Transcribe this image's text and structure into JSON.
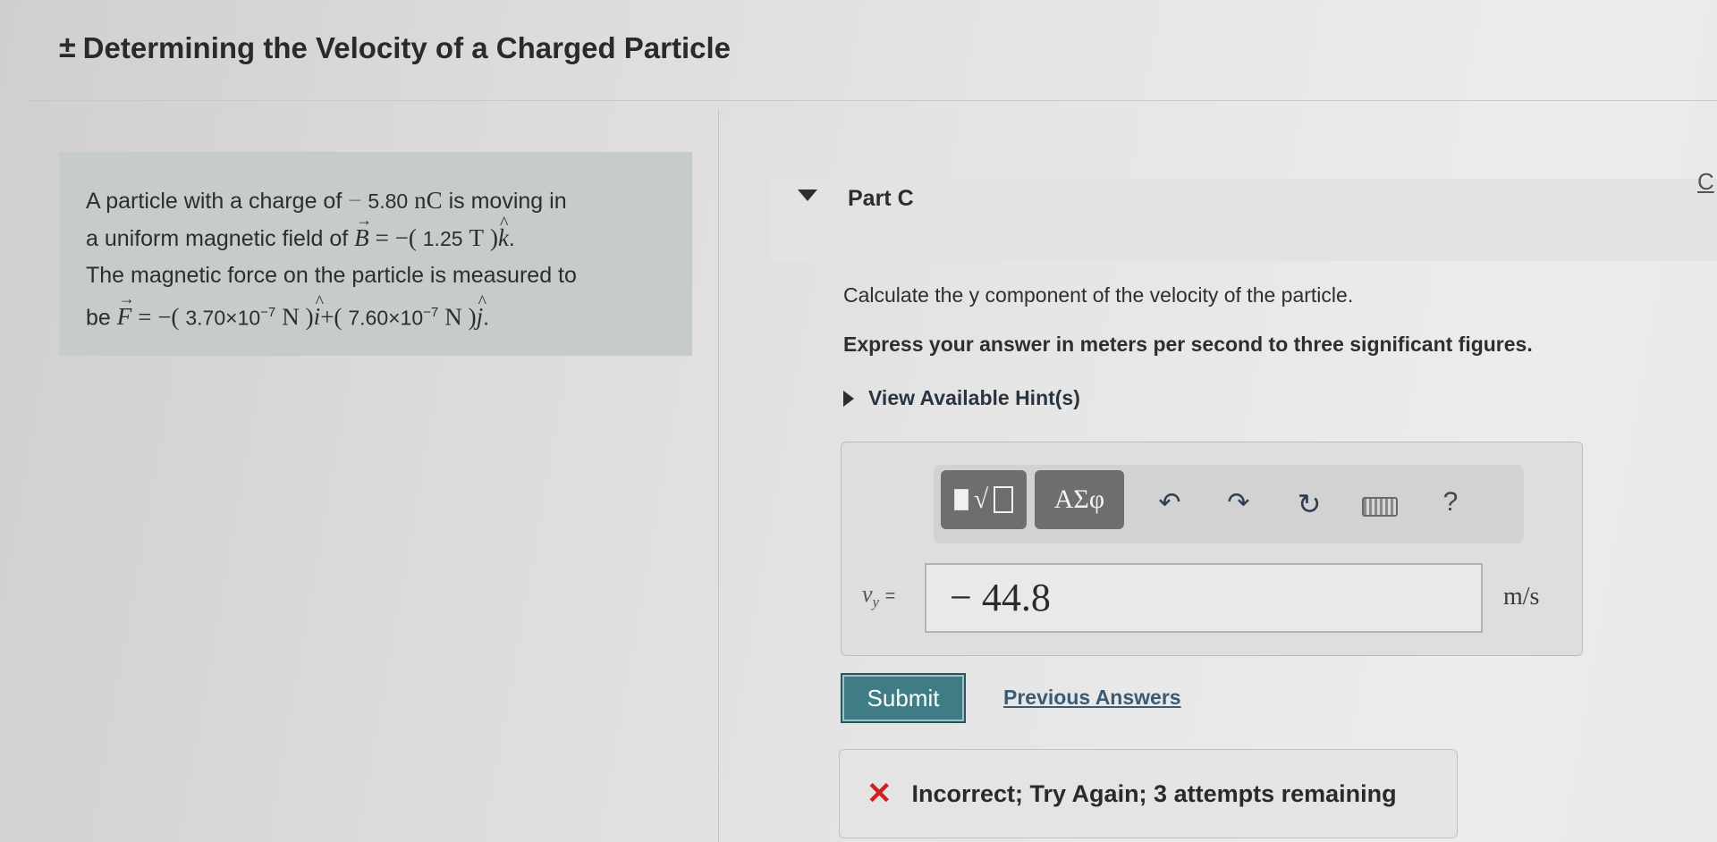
{
  "header": {
    "toggle_symbol": "±",
    "title": "Determining the Velocity of a Charged Particle"
  },
  "problem": {
    "line1_pre": "A particle with a charge of",
    "charge_sign": "−",
    "charge_value": "5.80",
    "charge_unit": "nC",
    "line1_post": "is moving in",
    "line2_pre": "a uniform magnetic field of",
    "field_vector": "B",
    "field_expr_pre": "= −(",
    "field_value": "1.25",
    "field_unit": "T",
    "field_expr_post": ")",
    "field_dir": "k",
    "line3": "The magnetic force on the particle is measured to",
    "line4_pre": "be",
    "force_vector": "F",
    "force_expr_1": "= −(",
    "force_value_1_mantissa": "3.70×10",
    "force_value_1_exp": "−7",
    "force_unit_1": "N",
    "force_expr_2": ")",
    "force_dir_1": "i",
    "force_expr_3": "+(",
    "force_value_2_mantissa": "7.60×10",
    "force_value_2_exp": "−7",
    "force_unit_2": "N",
    "force_expr_4": ")",
    "force_dir_2": "j"
  },
  "part": {
    "label": "Part C",
    "edge_link": "C",
    "question": "Calculate the y component of the velocity of the particle.",
    "instruction": "Express your answer in meters per second to three significant figures.",
    "hint_label": "View Available Hint(s)"
  },
  "toolbar": {
    "template_root_symbol": "√",
    "greek_label": "ΑΣφ",
    "undo_icon": "undo-arrow",
    "redo_icon": "redo-arrow",
    "reset_icon": "reset-circle-arrow",
    "keyboard_icon": "keyboard",
    "help_label": "?"
  },
  "answer": {
    "variable": "v",
    "variable_sub": "y",
    "equals": "=",
    "value": "− 44.8",
    "unit": "m/s"
  },
  "actions": {
    "submit_label": "Submit",
    "previous_answers_label": "Previous Answers"
  },
  "feedback": {
    "icon": "✕",
    "text": "Incorrect; Try Again; 3 attempts remaining",
    "color": "#d02020"
  }
}
